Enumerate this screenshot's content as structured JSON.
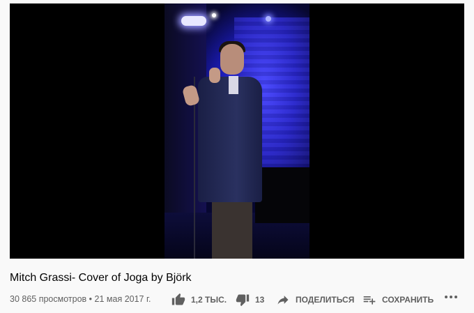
{
  "video": {
    "title": "Mitch Grassi- Cover of Joga by Björk",
    "views": "30 865 просмотров",
    "separator": "•",
    "date": "21 мая 2017 г."
  },
  "actions": {
    "like_count": "1,2 ТЫС.",
    "dislike_count": "13",
    "share_label": "ПОДЕЛИТЬСЯ",
    "save_label": "СОХРАНИТЬ"
  },
  "icons": {
    "like": "thumbs-up-icon",
    "dislike": "thumbs-down-icon",
    "share": "share-arrow-icon",
    "save": "playlist-add-icon",
    "more": "more-horizontal-icon"
  },
  "colors": {
    "background": "#f9f9f9",
    "title": "#030303",
    "meta": "#606060",
    "stage_light": "#2526d8"
  }
}
